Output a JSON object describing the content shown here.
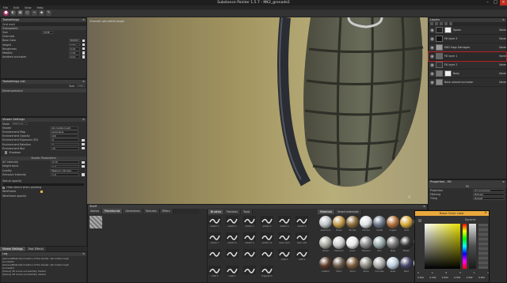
{
  "app": {
    "title": "Substance Painter 1.5.7 - MK2_grenade2"
  },
  "menu": [
    "File",
    "Edit",
    "View",
    "Help"
  ],
  "toolbar": {
    "icons": [
      "brush-icon",
      "eraser-icon",
      "projection-icon",
      "clone-icon",
      "smudge-icon",
      "polygon-fill-icon",
      "picker-icon"
    ]
  },
  "tool_settings": {
    "title": "Toolsettings",
    "headers": [
      "Grid shell",
      "Transparent"
    ],
    "rows": [
      {
        "label": "Size",
        "value": "2048"
      },
      {
        "label": "Channels",
        "value": ""
      },
      {
        "label": "Base Color",
        "value": "#0000"
      },
      {
        "label": "Height",
        "value": "0.00"
      },
      {
        "label": "Roughness",
        "value": "0.43"
      },
      {
        "label": "Metallic",
        "value": "1.03"
      },
      {
        "label": "Ambient occlusion",
        "value": "0.01"
      }
    ]
  },
  "toolsettings_list": {
    "title": "Toolsettings List",
    "size_label": "Size",
    "size_value": "100",
    "item": "Decompresseur"
  },
  "viewer_settings": {
    "title": "Viewer Settings",
    "mode_label": "Mode",
    "mode_value": "Material",
    "rows": [
      {
        "label": "Shader",
        "value": "pbr-metal-rough"
      },
      {
        "label": "Environment Map",
        "value": "panorama"
      },
      {
        "label": "Environment Opacity",
        "value": "100"
      },
      {
        "label": "Environment Exposure (EV)",
        "value": "0"
      },
      {
        "label": "Environment Rotation",
        "value": "0"
      },
      {
        "label": "Environment Blur",
        "value": "15"
      }
    ],
    "shadows_label": "Shadows",
    "shader_params_title": "Shader Parameters",
    "shader_rows": [
      {
        "label": "AO Intensity",
        "value": "0.70"
      },
      {
        "label": "Height force",
        "value": "1.0"
      },
      {
        "label": "Quality",
        "value": "Medium (16 spp)"
      },
      {
        "label": "Emissive Intensity",
        "value": "1.0"
      }
    ],
    "stencil_opacity_label": "Stencil opacity",
    "hide_stencil_label": "Hide stencil when painting",
    "wireframe_label": "Wireframe",
    "wireframe_opacity_label": "Wireframe opacity"
  },
  "bottom_tabs": [
    "Viewer Settings",
    "Post Effects"
  ],
  "log": {
    "title": "Log",
    "lines": [
      "[GeneralMaterial] Creation of the shader: pbr-metal-rough",
      "successful",
      "[GeneralMaterial] Creation of the shader: pbr-metal-rough",
      "successful",
      "[Scene] 3D scene successfully loaded",
      "[Scene] 3D scene successfully loaded"
    ]
  },
  "viewport": {
    "label": "Channel: pbr-metal-rough"
  },
  "layers": {
    "title": "Layers",
    "items": [
      {
        "name": "Spoon",
        "detail": "",
        "blend": "Norm",
        "value": "100"
      },
      {
        "name": "Fill layer 3",
        "detail": "",
        "blend": "Norm",
        "value": "100"
      },
      {
        "name": "Fill",
        "detail": "MK2 frags Damages",
        "blend": "Norm",
        "value": "100"
      },
      {
        "name": "Fill layer 1",
        "detail": "",
        "blend": "Norm",
        "value": "100"
      },
      {
        "name": "Fill layer 2",
        "detail": "",
        "blend": "Norm",
        "value": "100"
      },
      {
        "name": "Body",
        "detail": "",
        "blend": "Norm",
        "value": "100"
      },
      {
        "name": "Base colored occlusion",
        "detail": "",
        "blend": "Norm",
        "value": "100"
      }
    ]
  },
  "properties": {
    "title": "Properties - Fill",
    "section": "Fill",
    "rows": [
      {
        "label": "Projection",
        "value": "UV projection"
      },
      {
        "label": "Filtering",
        "value": "Bilinear"
      },
      {
        "label": "Tiling",
        "value": "Repeat"
      }
    ]
  },
  "shelf": {
    "title": "Shelf",
    "tabs": [
      "Alphas",
      "Procedurals",
      "Generators",
      "Textures",
      "Filters"
    ],
    "subtabs": [
      "Brushes",
      "Particles",
      "Tools"
    ],
    "brushes": [
      "artistic 1",
      "artistic 2",
      "artistic 3",
      "artistic 4",
      "artistic 5",
      "artistic 6",
      "artistic 7",
      "artistic 8",
      "artistic 9",
      "artistic 10",
      "basic hard",
      "basic soft",
      "",
      "",
      "",
      "",
      "chalk 1",
      "chalk 2",
      "chalk 3",
      "chalk 4",
      "",
      "fingerprint"
    ],
    "material_tabs": [
      "Materials",
      "Smart materials"
    ],
    "materials": [
      "Aluminum",
      "Brass",
      "Bronze",
      "Chrome",
      "Cobalt",
      "Copper",
      "Gold",
      "Iron",
      "Nickel",
      "Platinum",
      "Silver",
      "Titanium",
      "Zinc",
      "Steel",
      "Plastic",
      "Rubber",
      "Leather",
      "Fabric",
      "Wood",
      "Stone",
      "Concrete",
      "Glass",
      "Paint",
      "Ceramic"
    ]
  },
  "color_picker": {
    "title": "Base Color color",
    "mode": "Dynamic",
    "labels": [
      "R",
      "G",
      "B",
      "H",
      "S",
      "V"
    ],
    "values": [
      "0.302",
      "0.302",
      "0.302",
      "0.302",
      "0.302",
      "0.302"
    ]
  },
  "colors": {
    "accent": "#b0306a",
    "selection": "#b82222"
  }
}
